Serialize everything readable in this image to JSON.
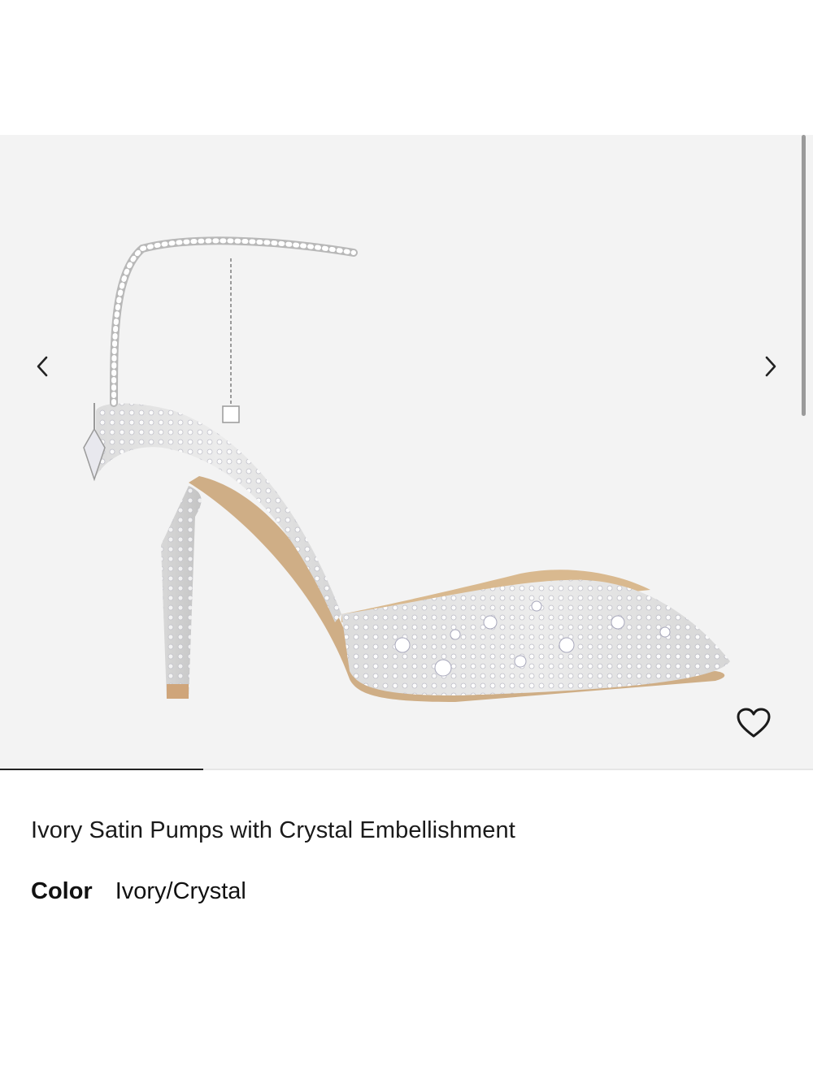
{
  "gallery": {
    "image_alt": "crystal-embellished pointed pump with ankle chain",
    "prev_icon": "chevron-left-icon",
    "next_icon": "chevron-right-icon",
    "wishlist_icon": "heart-outline-icon",
    "slide_progress": 0.25
  },
  "product": {
    "title": "Ivory Satin Pumps with Crystal Embellishment",
    "color_label": "Color",
    "color_value": "Ivory/Crystal"
  },
  "colors": {
    "gallery_bg": "#f3f3f3",
    "text": "#111111",
    "indicator_active": "#222222"
  }
}
